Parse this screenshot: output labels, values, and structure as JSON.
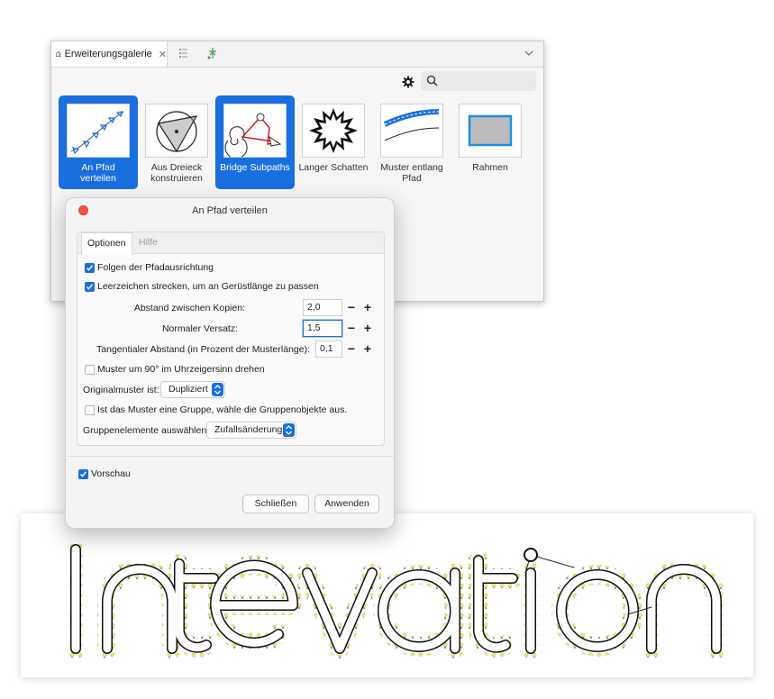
{
  "gallery": {
    "tab_label": "Erweiterungsgalerie",
    "tab_close": "✕",
    "search_placeholder": "",
    "items": [
      {
        "label_line1": "An Pfad",
        "label_line2": "verteilen",
        "selected": true
      },
      {
        "label_line1": "Aus Dreieck",
        "label_line2": "konstruieren",
        "selected": false
      },
      {
        "label_line1": "Bridge Subpaths",
        "label_line2": "",
        "selected": true
      },
      {
        "label_line1": "Langer Schatten",
        "label_line2": "",
        "selected": false
      },
      {
        "label_line1": "Muster entlang",
        "label_line2": "Pfad",
        "selected": false
      },
      {
        "label_line1": "Rahmen",
        "label_line2": "",
        "selected": false
      }
    ]
  },
  "dialog": {
    "title": "An Pfad verteilen",
    "tabs": {
      "options": "Optionen",
      "help": "Hilfe"
    },
    "follow_path": {
      "label": "Folgen der Pfadausrichtung",
      "checked": true
    },
    "stretch_spaces": {
      "label": "Leerzeichen strecken, um an Gerüstlänge zu passen",
      "checked": true
    },
    "spacing": {
      "label": "Abstand zwischen Kopien:",
      "value": "2,0"
    },
    "normal_offset": {
      "label": "Normaler Versatz:",
      "value": "1,5"
    },
    "tangential_offset": {
      "label": "Tangentialer Abstand (in Prozent der Musterlänge):",
      "value": "0,1"
    },
    "stepper_minus": "−",
    "stepper_plus": "+",
    "rotate_90": {
      "label": "Muster um 90° im Uhrzeigersinn drehen",
      "checked": false
    },
    "original_pattern": {
      "label": "Originalmuster ist:",
      "value": "Dupliziert"
    },
    "group_objects": {
      "label": "Ist das Muster eine Gruppe, wähle die Gruppenobjekte aus.",
      "checked": false
    },
    "group_select": {
      "label": "Gruppenelemente auswählen:",
      "value": "Zufallsänderung"
    },
    "preview": {
      "label": "Vorschau",
      "checked": true
    },
    "close_button": "Schließen",
    "apply_button": "Anwenden"
  },
  "canvas": {
    "word": "Intevation"
  },
  "colors": {
    "accent": "#1a6fe0",
    "close_dot": "#f1554c",
    "bulb": "#f3ea4a"
  }
}
